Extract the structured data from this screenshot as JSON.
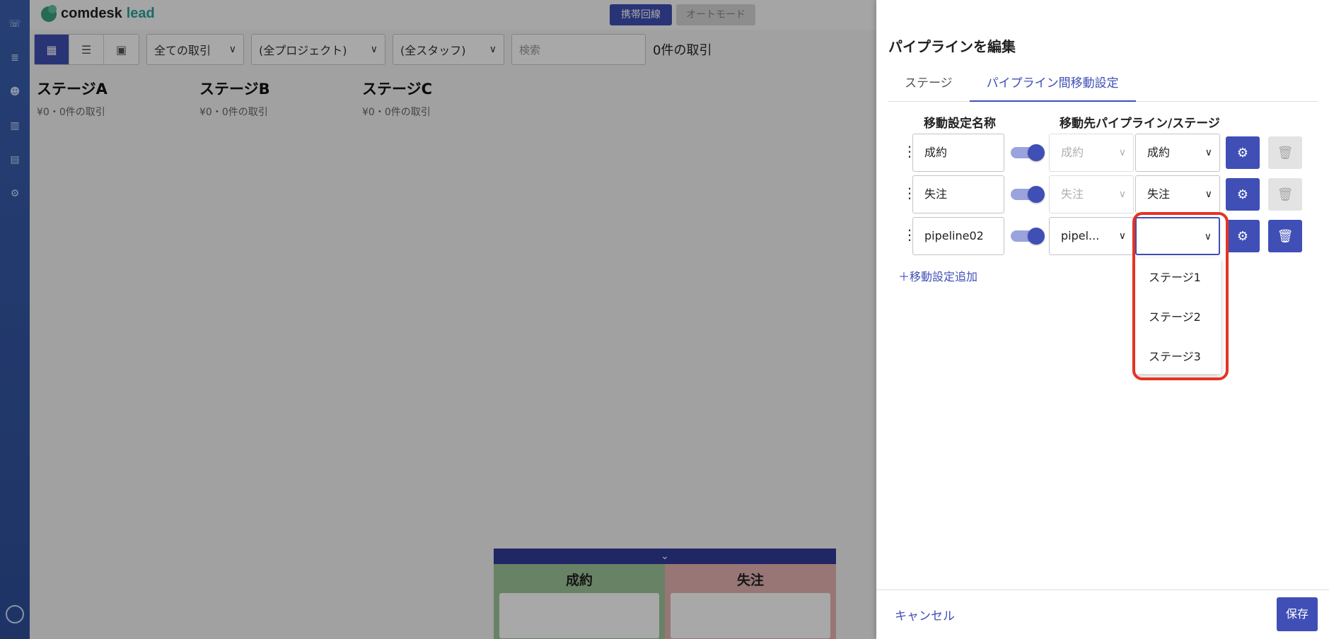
{
  "app": {
    "logo_text": "comdesk",
    "logo_accent": "lead",
    "header_buttons": [
      {
        "label": "携帯回線",
        "state": "active"
      },
      {
        "label": "オートモード",
        "state": "inactive"
      }
    ]
  },
  "nav_icons": [
    "phone-icon",
    "database-icon",
    "users-icon",
    "chart-icon",
    "board-icon",
    "gear-icon",
    "user-circle-icon"
  ],
  "toolbar": {
    "view_icons": [
      "grid-icon",
      "list-icon",
      "calendar-icon"
    ],
    "deal_filter": "全ての取引",
    "project_filter": "(全プロジェクト)",
    "staff_filter": "(全スタッフ)",
    "search_placeholder": "検索",
    "deal_count": "0件の取引"
  },
  "stages": [
    {
      "title": "ステージA",
      "summary": "¥0・0件の取引"
    },
    {
      "title": "ステージB",
      "summary": "¥0・0件の取引"
    },
    {
      "title": "ステージC",
      "summary": "¥0・0件の取引"
    }
  ],
  "bottom_panel": {
    "columns": [
      "成約",
      "失注"
    ],
    "colors": {
      "won": "#9fc59a",
      "lost": "#e7b4b4"
    }
  },
  "drawer": {
    "title": "パイプラインを編集",
    "tabs": [
      {
        "label": "ステージ",
        "active": false
      },
      {
        "label": "パイプライン間移動設定",
        "active": true
      }
    ],
    "column_headers": {
      "name": "移動設定名称",
      "destination": "移動先パイプライン/ステージ"
    },
    "rows": [
      {
        "name": "成約",
        "enabled": true,
        "pipeline": "成約",
        "pipeline_disabled": true,
        "stage": "成約",
        "deletable": false
      },
      {
        "name": "失注",
        "enabled": true,
        "pipeline": "失注",
        "pipeline_disabled": true,
        "stage": "失注",
        "deletable": false
      },
      {
        "name": "pipeline02",
        "enabled": true,
        "pipeline": "pipel...",
        "pipeline_disabled": false,
        "stage": "",
        "deletable": true
      }
    ],
    "add_link": "移動設定追加",
    "stage_menu_options": [
      "ステージ1",
      "ステージ2",
      "ステージ3"
    ],
    "cancel_label": "キャンセル",
    "save_label": "保存"
  },
  "colors": {
    "accent": "#3f4fb5",
    "highlight": "#e53322",
    "nav": "#3a5fb0"
  }
}
